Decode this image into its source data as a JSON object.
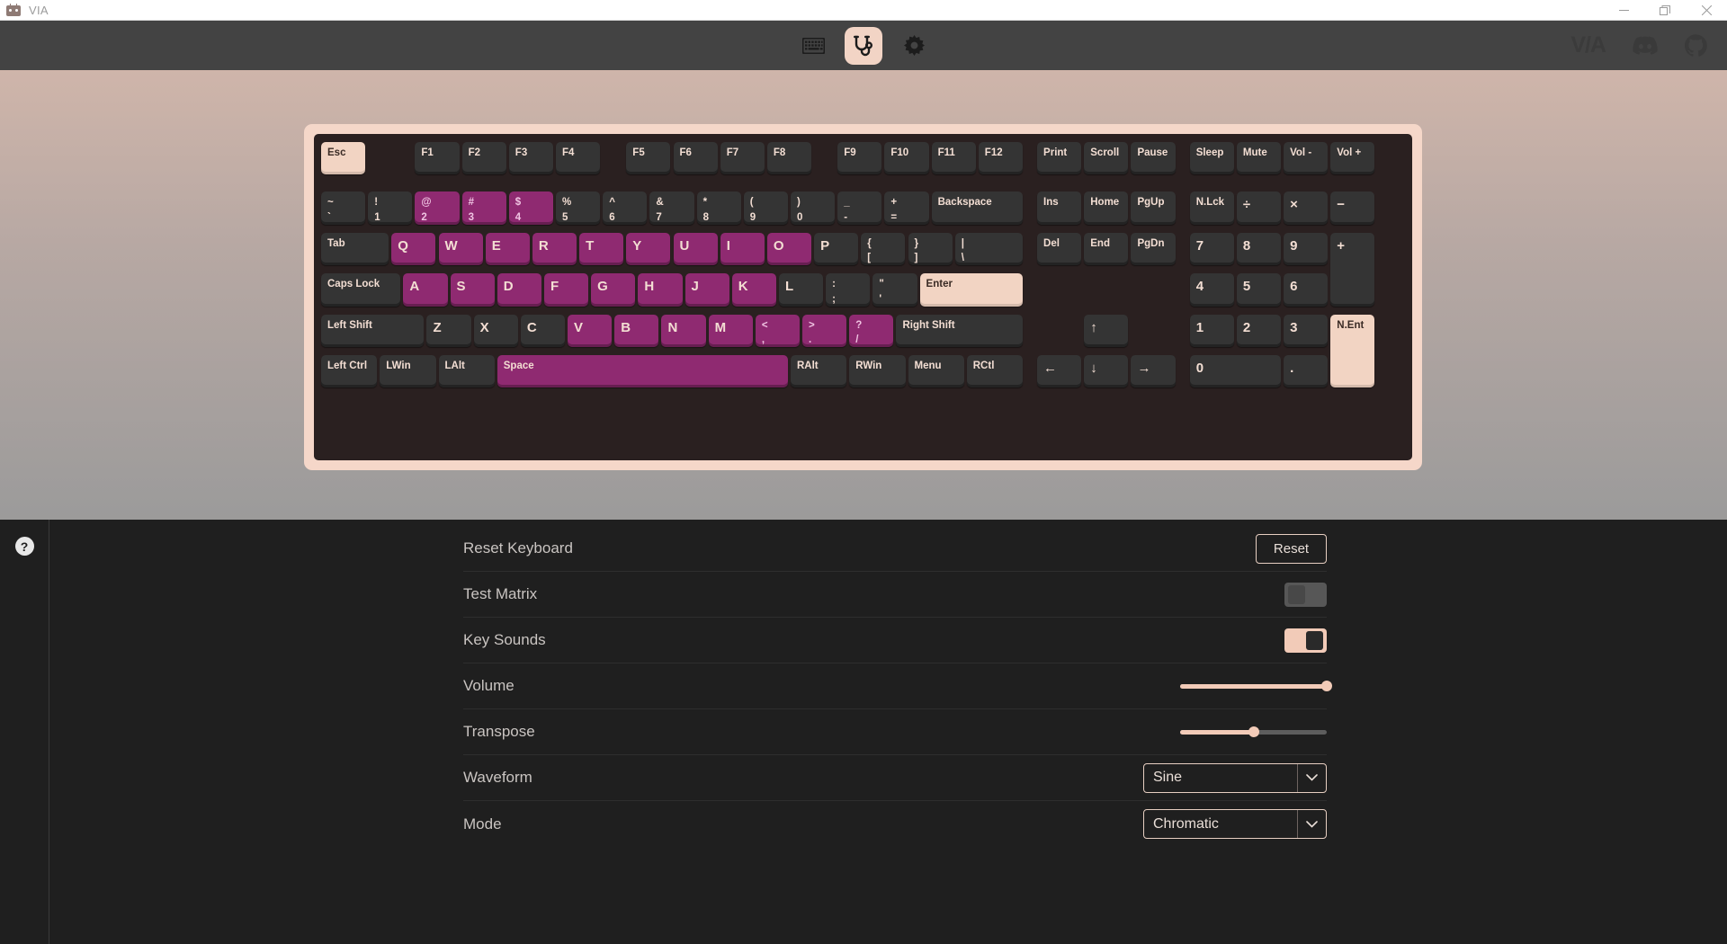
{
  "window": {
    "title": "VIA",
    "app_icon": "via-robot-icon",
    "controls": [
      {
        "name": "minimize",
        "glyph": "minimize-icon"
      },
      {
        "name": "maximize",
        "glyph": "maximize-icon"
      },
      {
        "name": "close",
        "glyph": "close-icon"
      }
    ]
  },
  "toolbar": {
    "tools": [
      {
        "name": "keyboard",
        "icon": "keyboard-icon",
        "active": false
      },
      {
        "name": "test",
        "icon": "stethoscope-icon",
        "active": true
      },
      {
        "name": "settings",
        "icon": "gear-icon",
        "active": false
      }
    ],
    "right": {
      "logo": "V/A",
      "links": [
        {
          "name": "discord",
          "icon": "discord-icon"
        },
        {
          "name": "github",
          "icon": "github-icon"
        }
      ]
    }
  },
  "keyboard": {
    "rows": [
      [
        {
          "label": "Esc",
          "x": 0,
          "w": 1,
          "state": "selected"
        },
        {
          "label": "F1",
          "x": 2,
          "w": 1
        },
        {
          "label": "F2",
          "x": 3,
          "w": 1
        },
        {
          "label": "F3",
          "x": 4,
          "w": 1
        },
        {
          "label": "F4",
          "x": 5,
          "w": 1
        },
        {
          "label": "F5",
          "x": 6.5,
          "w": 1
        },
        {
          "label": "F6",
          "x": 7.5,
          "w": 1
        },
        {
          "label": "F7",
          "x": 8.5,
          "w": 1
        },
        {
          "label": "F8",
          "x": 9.5,
          "w": 1
        },
        {
          "label": "F9",
          "x": 11,
          "w": 1
        },
        {
          "label": "F10",
          "x": 12,
          "w": 1
        },
        {
          "label": "F11",
          "x": 13,
          "w": 1
        },
        {
          "label": "F12",
          "x": 14,
          "w": 1
        },
        {
          "label": "Print",
          "x": 15.25,
          "w": 1
        },
        {
          "label": "Scroll",
          "x": 16.25,
          "w": 1
        },
        {
          "label": "Pause",
          "x": 17.25,
          "w": 1
        },
        {
          "label": "Sleep",
          "x": 18.5,
          "w": 1
        },
        {
          "label": "Mute",
          "x": 19.5,
          "w": 1
        },
        {
          "label": "Vol -",
          "x": 20.5,
          "w": 1
        },
        {
          "label": "Vol +",
          "x": 21.5,
          "w": 1
        }
      ],
      [
        {
          "top": "~",
          "bottom": "`",
          "x": 0,
          "w": 1
        },
        {
          "top": "!",
          "bottom": "1",
          "x": 1,
          "w": 1
        },
        {
          "top": "@",
          "bottom": "2",
          "x": 2,
          "w": 1,
          "state": "highlight"
        },
        {
          "top": "#",
          "bottom": "3",
          "x": 3,
          "w": 1,
          "state": "highlight"
        },
        {
          "top": "$",
          "bottom": "4",
          "x": 4,
          "w": 1,
          "state": "highlight"
        },
        {
          "top": "%",
          "bottom": "5",
          "x": 5,
          "w": 1
        },
        {
          "top": "^",
          "bottom": "6",
          "x": 6,
          "w": 1
        },
        {
          "top": "&",
          "bottom": "7",
          "x": 7,
          "w": 1
        },
        {
          "top": "*",
          "bottom": "8",
          "x": 8,
          "w": 1
        },
        {
          "top": "(",
          "bottom": "9",
          "x": 9,
          "w": 1
        },
        {
          "top": ")",
          "bottom": "0",
          "x": 10,
          "w": 1
        },
        {
          "top": "_",
          "bottom": "-",
          "x": 11,
          "w": 1
        },
        {
          "top": "+",
          "bottom": "=",
          "x": 12,
          "w": 1
        },
        {
          "label": "Backspace",
          "x": 13,
          "w": 2
        },
        {
          "label": "Ins",
          "x": 15.25,
          "w": 1
        },
        {
          "label": "Home",
          "x": 16.25,
          "w": 1
        },
        {
          "label": "PgUp",
          "x": 17.25,
          "w": 1
        },
        {
          "label": "N.Lck",
          "x": 18.5,
          "w": 1
        },
        {
          "label": "÷",
          "x": 19.5,
          "w": 1,
          "big": true
        },
        {
          "label": "×",
          "x": 20.5,
          "w": 1,
          "big": true
        },
        {
          "label": "−",
          "x": 21.5,
          "w": 1,
          "big": true
        }
      ],
      [
        {
          "label": "Tab",
          "x": 0,
          "w": 1.5
        },
        {
          "label": "Q",
          "x": 1.5,
          "w": 1,
          "state": "highlight",
          "big": true
        },
        {
          "label": "W",
          "x": 2.5,
          "w": 1,
          "state": "highlight",
          "big": true
        },
        {
          "label": "E",
          "x": 3.5,
          "w": 1,
          "state": "highlight",
          "big": true
        },
        {
          "label": "R",
          "x": 4.5,
          "w": 1,
          "state": "highlight",
          "big": true
        },
        {
          "label": "T",
          "x": 5.5,
          "w": 1,
          "state": "highlight",
          "big": true
        },
        {
          "label": "Y",
          "x": 6.5,
          "w": 1,
          "state": "highlight",
          "big": true
        },
        {
          "label": "U",
          "x": 7.5,
          "w": 1,
          "state": "highlight",
          "big": true
        },
        {
          "label": "I",
          "x": 8.5,
          "w": 1,
          "state": "highlight",
          "big": true
        },
        {
          "label": "O",
          "x": 9.5,
          "w": 1,
          "state": "highlight",
          "big": true
        },
        {
          "label": "P",
          "x": 10.5,
          "w": 1,
          "big": true
        },
        {
          "top": "{",
          "bottom": "[",
          "x": 11.5,
          "w": 1
        },
        {
          "top": "}",
          "bottom": "]",
          "x": 12.5,
          "w": 1
        },
        {
          "top": "|",
          "bottom": "\\",
          "x": 13.5,
          "w": 1.5
        },
        {
          "label": "Del",
          "x": 15.25,
          "w": 1
        },
        {
          "label": "End",
          "x": 16.25,
          "w": 1
        },
        {
          "label": "PgDn",
          "x": 17.25,
          "w": 1
        },
        {
          "label": "7",
          "x": 18.5,
          "w": 1,
          "big": true
        },
        {
          "label": "8",
          "x": 19.5,
          "w": 1,
          "big": true
        },
        {
          "label": "9",
          "x": 20.5,
          "w": 1,
          "big": true
        },
        {
          "label": "+",
          "x": 21.5,
          "w": 1,
          "h": 2,
          "big": true
        }
      ],
      [
        {
          "label": "Caps Lock",
          "x": 0,
          "w": 1.75
        },
        {
          "label": "A",
          "x": 1.75,
          "w": 1,
          "state": "highlight",
          "big": true
        },
        {
          "label": "S",
          "x": 2.75,
          "w": 1,
          "state": "highlight",
          "big": true
        },
        {
          "label": "D",
          "x": 3.75,
          "w": 1,
          "state": "highlight",
          "big": true
        },
        {
          "label": "F",
          "x": 4.75,
          "w": 1,
          "state": "highlight",
          "big": true
        },
        {
          "label": "G",
          "x": 5.75,
          "w": 1,
          "state": "highlight",
          "big": true
        },
        {
          "label": "H",
          "x": 6.75,
          "w": 1,
          "state": "highlight",
          "big": true
        },
        {
          "label": "J",
          "x": 7.75,
          "w": 1,
          "state": "highlight",
          "big": true
        },
        {
          "label": "K",
          "x": 8.75,
          "w": 1,
          "state": "highlight",
          "big": true
        },
        {
          "label": "L",
          "x": 9.75,
          "w": 1,
          "big": true
        },
        {
          "top": ":",
          "bottom": ";",
          "x": 10.75,
          "w": 1
        },
        {
          "top": "\"",
          "bottom": "'",
          "x": 11.75,
          "w": 1
        },
        {
          "label": "Enter",
          "x": 12.75,
          "w": 2.25,
          "state": "selected"
        },
        {
          "label": "4",
          "x": 18.5,
          "w": 1,
          "big": true
        },
        {
          "label": "5",
          "x": 19.5,
          "w": 1,
          "big": true
        },
        {
          "label": "6",
          "x": 20.5,
          "w": 1,
          "big": true
        }
      ],
      [
        {
          "label": "Left Shift",
          "x": 0,
          "w": 2.25
        },
        {
          "label": "Z",
          "x": 2.25,
          "w": 1,
          "big": true
        },
        {
          "label": "X",
          "x": 3.25,
          "w": 1,
          "big": true
        },
        {
          "label": "C",
          "x": 4.25,
          "w": 1,
          "big": true
        },
        {
          "label": "V",
          "x": 5.25,
          "w": 1,
          "state": "highlight",
          "big": true
        },
        {
          "label": "B",
          "x": 6.25,
          "w": 1,
          "state": "highlight",
          "big": true
        },
        {
          "label": "N",
          "x": 7.25,
          "w": 1,
          "state": "highlight",
          "big": true
        },
        {
          "label": "M",
          "x": 8.25,
          "w": 1,
          "state": "highlight",
          "big": true
        },
        {
          "top": "<",
          "bottom": ",",
          "x": 9.25,
          "w": 1,
          "state": "highlight"
        },
        {
          "top": ">",
          "bottom": ".",
          "x": 10.25,
          "w": 1,
          "state": "highlight"
        },
        {
          "top": "?",
          "bottom": "/",
          "x": 11.25,
          "w": 1,
          "state": "highlight"
        },
        {
          "label": "Right Shift",
          "x": 12.25,
          "w": 2.75
        },
        {
          "label": "↑",
          "x": 16.25,
          "w": 1,
          "big": true
        },
        {
          "label": "1",
          "x": 18.5,
          "w": 1,
          "big": true
        },
        {
          "label": "2",
          "x": 19.5,
          "w": 1,
          "big": true
        },
        {
          "label": "3",
          "x": 20.5,
          "w": 1,
          "big": true
        },
        {
          "label": "N.Ent",
          "x": 21.5,
          "w": 1,
          "h": 2,
          "state": "selected"
        }
      ],
      [
        {
          "label": "Left Ctrl",
          "x": 0,
          "w": 1.25
        },
        {
          "label": "LWin",
          "x": 1.25,
          "w": 1.25
        },
        {
          "label": "LAlt",
          "x": 2.5,
          "w": 1.25
        },
        {
          "label": "Space",
          "x": 3.75,
          "w": 6.25,
          "state": "highlight"
        },
        {
          "label": "RAlt",
          "x": 10,
          "w": 1.25
        },
        {
          "label": "RWin",
          "x": 11.25,
          "w": 1.25
        },
        {
          "label": "Menu",
          "x": 12.5,
          "w": 1.25
        },
        {
          "label": "RCtl",
          "x": 13.75,
          "w": 1.25
        },
        {
          "label": "←",
          "x": 15.25,
          "w": 1,
          "big": true
        },
        {
          "label": "↓",
          "x": 16.25,
          "w": 1,
          "big": true
        },
        {
          "label": "→",
          "x": 17.25,
          "w": 1,
          "big": true
        },
        {
          "label": "0",
          "x": 18.5,
          "w": 2,
          "big": true
        },
        {
          "label": ".",
          "x": 20.5,
          "w": 1,
          "big": true
        }
      ]
    ]
  },
  "settings": {
    "help_glyph": "?",
    "rows": [
      {
        "label": "Reset Keyboard",
        "control": "button",
        "value": "Reset"
      },
      {
        "label": "Test Matrix",
        "control": "toggle",
        "value": "off"
      },
      {
        "label": "Key Sounds",
        "control": "toggle",
        "value": "on"
      },
      {
        "label": "Volume",
        "control": "slider",
        "value": 100
      },
      {
        "label": "Transpose",
        "control": "slider",
        "value": 50
      },
      {
        "label": "Waveform",
        "control": "select",
        "value": "Sine"
      },
      {
        "label": "Mode",
        "control": "select",
        "value": "Chromatic"
      }
    ]
  },
  "colors": {
    "accent": "#f2cbb8",
    "highlight_key": "#8f2a71",
    "selected_key": "#f2d4c3",
    "key_bg": "#343434",
    "panel_bg": "#1f1f1f",
    "toolbar_bg": "#434343"
  }
}
